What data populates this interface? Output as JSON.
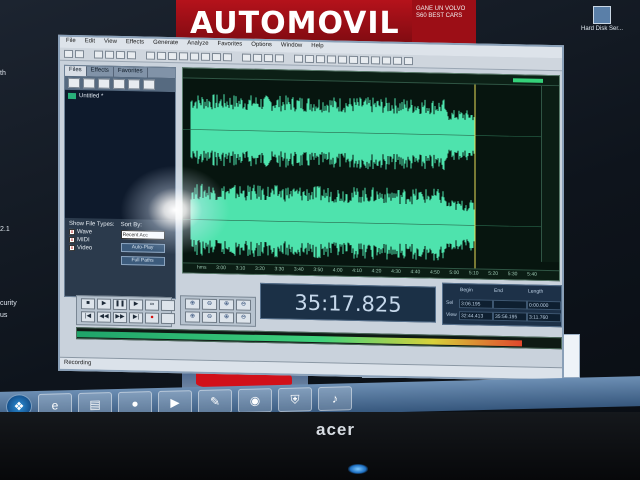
{
  "desktop": {
    "ad_banner": "AUTOMOVIL",
    "ad_side_text": "GANE UN VOLVO S60 BEST CARS",
    "right_icon_label": "Hard Disk Ser...",
    "left_fragments": [
      "th",
      "2.1",
      "curity",
      "us"
    ]
  },
  "menubar": [
    "File",
    "Edit",
    "View",
    "Effects",
    "Generate",
    "Analyze",
    "Favorites",
    "Options",
    "Window",
    "Help"
  ],
  "left_panel": {
    "tabs": [
      "Files",
      "Effects",
      "Favorites"
    ],
    "files": [
      {
        "name": "Untitled *"
      }
    ],
    "show_file_types_label": "Show File Types:",
    "types": [
      {
        "label": "Wave",
        "checked": true
      },
      {
        "label": "MIDI",
        "checked": true
      },
      {
        "label": "Video",
        "checked": true
      }
    ],
    "sort_by_label": "Sort By:",
    "sort_value": "Recent Acc",
    "auto_play": "Auto-Play",
    "full_paths": "Full Paths"
  },
  "waveform": {
    "time_ticks": [
      "hms",
      "3:00",
      "3:10",
      "3:20",
      "3:30",
      "3:40",
      "3:50",
      "4:00",
      "4:10",
      "4:20",
      "4:30",
      "4:40",
      "4:50",
      "5:00",
      "5:10",
      "5:20",
      "5:30",
      "5:40"
    ]
  },
  "transport": {
    "buttons": [
      "■",
      "▶",
      "❚❚",
      "▶",
      "∞",
      "",
      "|◀",
      "◀◀",
      "▶▶",
      "▶|",
      "●",
      ""
    ]
  },
  "zoom": {
    "buttons": [
      "⊕",
      "⊖",
      "⊕",
      "⊖",
      "⊕",
      "⊖",
      "⊕",
      "⊖"
    ]
  },
  "time_display": "35:17.825",
  "selection": {
    "headers": [
      "",
      "Begin",
      "End",
      "Length"
    ],
    "rows": [
      [
        "Sel",
        "3:06.195",
        "",
        "0:00.000"
      ],
      [
        "View",
        "32:44.413",
        "35:56.195",
        "3:11.760"
      ]
    ]
  },
  "level_meter": {
    "level": 0.92
  },
  "status": {
    "text": "Recording"
  }
}
